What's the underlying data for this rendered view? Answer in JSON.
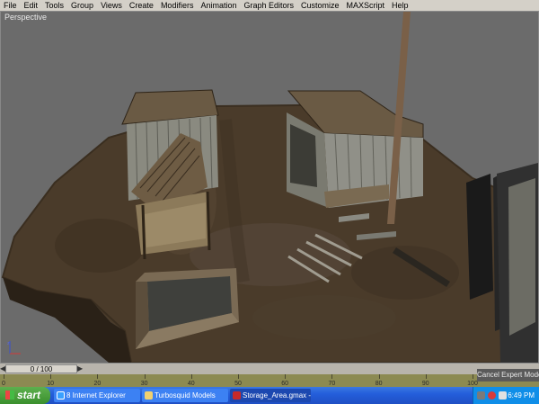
{
  "menubar": {
    "items": [
      "File",
      "Edit",
      "Tools",
      "Group",
      "Views",
      "Create",
      "Modifiers",
      "Animation",
      "Graph Editors",
      "Customize",
      "MAXScript",
      "Help"
    ]
  },
  "viewport": {
    "label": "Perspective"
  },
  "timeslider": {
    "position": "0 / 100",
    "current_frame": 0,
    "total_frames": 100
  },
  "trackbar": {
    "ticks": [
      "0",
      "10",
      "20",
      "30",
      "40",
      "50",
      "60",
      "70",
      "80",
      "90",
      "100"
    ]
  },
  "expert_mode": {
    "button_label": "Cancel Expert Mode"
  },
  "taskbar": {
    "start_label": "start",
    "tasks": [
      {
        "label": "8 Internet Explorer",
        "icon": "internet-explorer-icon"
      },
      {
        "label": "Turbosquid Models",
        "icon": "folder-icon"
      },
      {
        "label": "Storage_Area.gmax -...",
        "icon": "gmax-icon"
      }
    ],
    "clock": "6:49 PM"
  },
  "colors": {
    "menubar": "#d4d0c8",
    "viewport_bg": "#6b6b6b",
    "trackbar": "#8c8a52",
    "taskbar": "#245edb",
    "start_green": "#3a8f2d",
    "tray": "#0f8ee8"
  }
}
